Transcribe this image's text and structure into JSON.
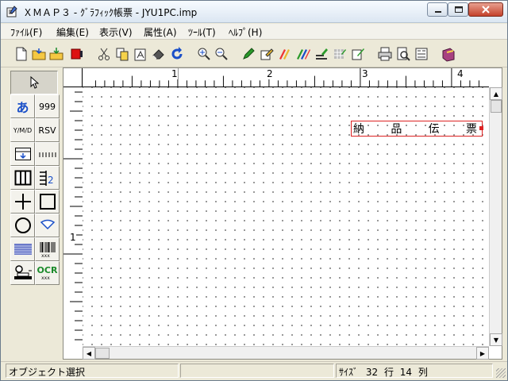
{
  "window": {
    "title": "ＸＭＡＰ３ - ｸﾞﾗﾌｨｯｸ帳票 - JYU1PC.imp",
    "controls": {
      "minimize": "minimize-icon",
      "maximize": "maximize-icon",
      "close": "close-icon"
    }
  },
  "menu": {
    "items": [
      {
        "label": "ﾌｧｲﾙ(F)"
      },
      {
        "label": "編集(E)"
      },
      {
        "label": "表示(V)"
      },
      {
        "label": "属性(A)"
      },
      {
        "label": "ﾂｰﾙ(T)"
      },
      {
        "label": "ﾍﾙﾌﾟ(H)"
      }
    ]
  },
  "toolbar": {
    "icons": [
      "new-icon",
      "open-icon",
      "save-icon",
      "record-icon",
      "cut-icon",
      "copy-icon",
      "paste-icon",
      "erase-icon",
      "undo-icon",
      "zoom-in-icon",
      "zoom-out-icon",
      "pen-icon",
      "edit-box-icon",
      "multi-pen-icon",
      "pen-set-icon",
      "line-tool-icon",
      "pattern-icon",
      "print-image-icon",
      "print-icon",
      "print-preview-icon",
      "layout-icon",
      "book-icon"
    ]
  },
  "palette": {
    "items": [
      {
        "label": "",
        "icon": "pointer-icon"
      },
      {
        "label": "あ",
        "icon": "text-icon"
      },
      {
        "label": "999",
        "icon": "number-icon"
      },
      {
        "label": "Y/M/D",
        "icon": "date-icon"
      },
      {
        "label": "RSV",
        "icon": "reserve-icon"
      },
      {
        "label": "",
        "icon": "repeat-icon"
      },
      {
        "label": "",
        "icon": "ruler-icon"
      },
      {
        "label": "",
        "icon": "table-icon"
      },
      {
        "label": "",
        "icon": "list-number-icon"
      },
      {
        "label": "",
        "icon": "cross-line-icon"
      },
      {
        "label": "",
        "icon": "rectangle-icon"
      },
      {
        "label": "",
        "icon": "circle-icon"
      },
      {
        "label": "",
        "icon": "shape-icon"
      },
      {
        "label": "",
        "icon": "hatch-icon"
      },
      {
        "label": "",
        "icon": "barcode-icon"
      },
      {
        "label": "",
        "icon": "stamp-icon"
      },
      {
        "label": "OCR",
        "icon": "ocr-icon"
      }
    ]
  },
  "ruler": {
    "horizontal_labels": [
      "1",
      "2",
      "3",
      "4"
    ],
    "vertical_labels": [
      "1"
    ]
  },
  "canvas": {
    "field_text": [
      "納",
      "品",
      "伝",
      "票"
    ]
  },
  "status": {
    "message": "オブジェクト選択",
    "size_label": "ｻｲｽﾞ",
    "size_value": "32",
    "row_label": "行",
    "row_value": "14",
    "col_label": "列"
  },
  "colors": {
    "field_border": "#dd2222",
    "accent": "#1a4fc8"
  }
}
